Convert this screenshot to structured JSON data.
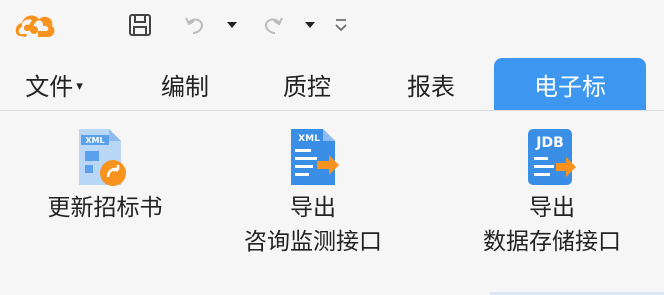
{
  "quick_access": {
    "icons": [
      "app-logo-icon",
      "save-icon",
      "undo-icon",
      "redo-icon",
      "customize-icon"
    ]
  },
  "tabs": [
    {
      "label": "文件",
      "has_caret": true
    },
    {
      "label": "编制"
    },
    {
      "label": "质控"
    },
    {
      "label": "报表"
    },
    {
      "label": "电子标",
      "active": true
    }
  ],
  "ribbon": {
    "update_tender": {
      "label": "更新招标书",
      "icon": "xml-update-icon"
    },
    "export_monitor": {
      "line1": "导出",
      "line2": "咨询监测接口",
      "icon": "xml-export-icon"
    },
    "export_storage": {
      "line1": "导出",
      "line2": "数据存储接口",
      "icon": "jdb-export-icon"
    }
  },
  "colors": {
    "accent": "#3d96f0",
    "logo_orange": "#f7931e",
    "icon_blue": "#3a8ee6",
    "icon_orange": "#f7931e"
  }
}
